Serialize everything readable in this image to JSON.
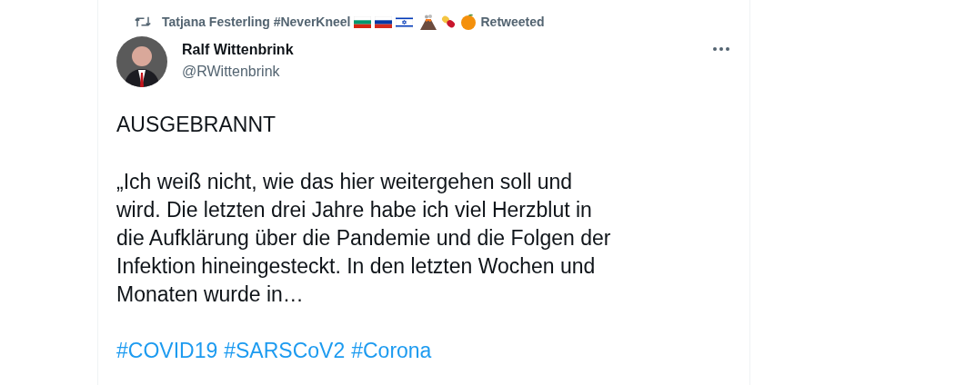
{
  "retweet_banner": {
    "retweeter": "Tatjana Festerling #NeverKneel",
    "emoji": [
      {
        "kind": "flag-bg"
      },
      {
        "kind": "flag-ru"
      },
      {
        "kind": "flag-il"
      },
      {
        "kind": "volcano"
      },
      {
        "kind": "pill"
      },
      {
        "kind": "orange"
      }
    ],
    "label": "Retweeted"
  },
  "author": {
    "name": "Ralf Wittenbrink",
    "handle": "@RWittenbrink"
  },
  "tweet": {
    "headline": "AUSGEBRANNT",
    "text": "„Ich weiß nicht, wie das hier weitergehen soll und\nwird. Die letzten drei Jahre habe ich viel Herzblut in\ndie Aufklärung über die Pandemie und die Folgen der\nInfektion hineingesteckt. In den letzten Wochen und\nMonaten wurde in…",
    "hashtags": [
      "#COVID19",
      "#SARSCoV2",
      "#Corona"
    ]
  }
}
